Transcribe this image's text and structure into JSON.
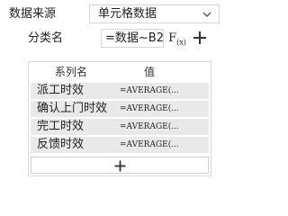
{
  "data_source": {
    "label": "数据来源",
    "selected": "单元格数据",
    "icon": "chevron-down-icon"
  },
  "category": {
    "label": "分类名",
    "value": "=数据~B2",
    "fx_label": "F",
    "fx_sub": "(x)",
    "add_icon": "plus-icon"
  },
  "series": {
    "headers": {
      "name": "系列名",
      "value": "值"
    },
    "rows": [
      {
        "name": "派工时效",
        "value": "=AVERAGE(..."
      },
      {
        "name": "确认上门时效",
        "value": "=AVERAGE(..."
      },
      {
        "name": "完工时效",
        "value": "=AVERAGE(..."
      },
      {
        "name": "反馈时效",
        "value": "=AVERAGE(..."
      }
    ],
    "add_icon": "plus-icon"
  }
}
